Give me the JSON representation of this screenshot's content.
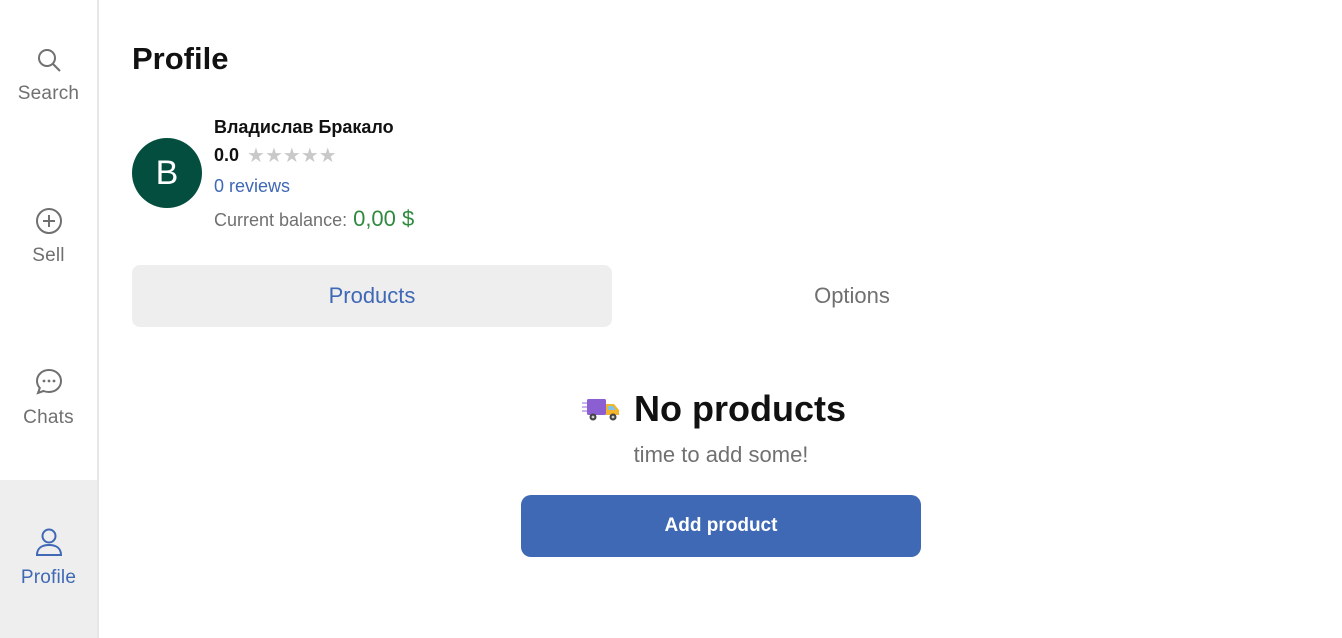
{
  "sidebar": {
    "items": [
      {
        "label": "Search",
        "icon": "search-icon"
      },
      {
        "label": "Sell",
        "icon": "plus-circle-icon"
      },
      {
        "label": "Chats",
        "icon": "chat-bubble-icon"
      },
      {
        "label": "Profile",
        "icon": "user-icon",
        "active": true
      }
    ]
  },
  "page": {
    "title": "Profile"
  },
  "user": {
    "initial": "B",
    "name": "Владислав Бракало",
    "rating": "0.0",
    "stars_filled": 0,
    "stars_total": 5,
    "reviews": "0 reviews",
    "balance_label": "Current balance:",
    "balance_amount": "0,00 $"
  },
  "tabs": [
    {
      "label": "Products",
      "active": true
    },
    {
      "label": "Options",
      "active": false
    }
  ],
  "empty_state": {
    "icon": "delivery-truck-icon",
    "title": "No products",
    "subtitle": "time to add some!",
    "button_label": "Add product"
  },
  "colors": {
    "accent": "#3f68b5",
    "avatar_bg": "#034e3f",
    "balance": "#2f8a3f",
    "muted": "#707070",
    "active_bg": "#eeeeee"
  }
}
